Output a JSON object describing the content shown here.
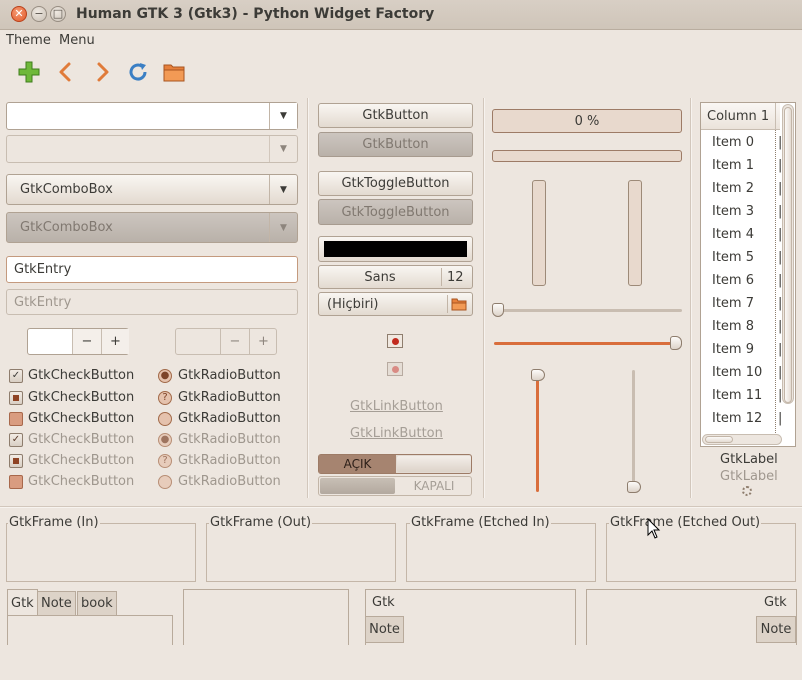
{
  "window": {
    "title": "Human GTK 3 (Gtk3) - Python Widget Factory"
  },
  "menubar": {
    "items": [
      "Theme",
      "Menu"
    ]
  },
  "toolbar": {
    "icons": [
      "add-icon",
      "back-icon",
      "forward-icon",
      "refresh-icon",
      "open-folder-icon"
    ]
  },
  "col1": {
    "combo_entry_value": "",
    "combo_label": "GtkComboBox",
    "combo_disabled_label": "GtkComboBox",
    "entry_value": "GtkEntry",
    "entry_disabled_value": "GtkEntry",
    "spin_value": "",
    "spin_minus": "−",
    "spin_plus": "+",
    "check_label": "GtkCheckButton",
    "radio_label": "GtkRadioButton"
  },
  "col2": {
    "button_label": "GtkButton",
    "button_disabled_label": "GtkButton",
    "toggle_label": "GtkToggleButton",
    "toggle_disabled_label": "GtkToggleButton",
    "color_button": "#000000",
    "font_name": "Sans",
    "font_size": "12",
    "file_chooser": "(Hiçbiri)",
    "link_label": "GtkLinkButton",
    "switch_on": "AÇIK",
    "switch_off": "KAPALI"
  },
  "col3": {
    "progress_text": "0 %",
    "progress_fraction": 0,
    "hscale1_fraction": 0.0,
    "hscale2_fraction": 1.0,
    "vscale1_fraction": 0.0,
    "vscale2_fraction": 1.0
  },
  "col4": {
    "column_header": "Column 1",
    "items": [
      "Item 0",
      "Item 1",
      "Item 2",
      "Item 3",
      "Item 4",
      "Item 5",
      "Item 6",
      "Item 7",
      "Item 8",
      "Item 9",
      "Item 10",
      "Item 11",
      "Item 12"
    ],
    "label": "GtkLabel",
    "label_disabled": "GtkLabel"
  },
  "frames": [
    "GtkFrame (In)",
    "GtkFrame (Out)",
    "GtkFrame (Etched In)",
    "GtkFrame (Etched Out)"
  ],
  "notebooks": {
    "nb1": [
      "Gtk",
      "Note",
      "book"
    ],
    "nb2_top": "Gtk",
    "nb2_left": "Note",
    "nb3_top": "Gtk",
    "nb3_right": "Note"
  },
  "colors": {
    "accent": "#d96e3c",
    "bg": "#ede6df",
    "check_accent": "#8f4324"
  }
}
